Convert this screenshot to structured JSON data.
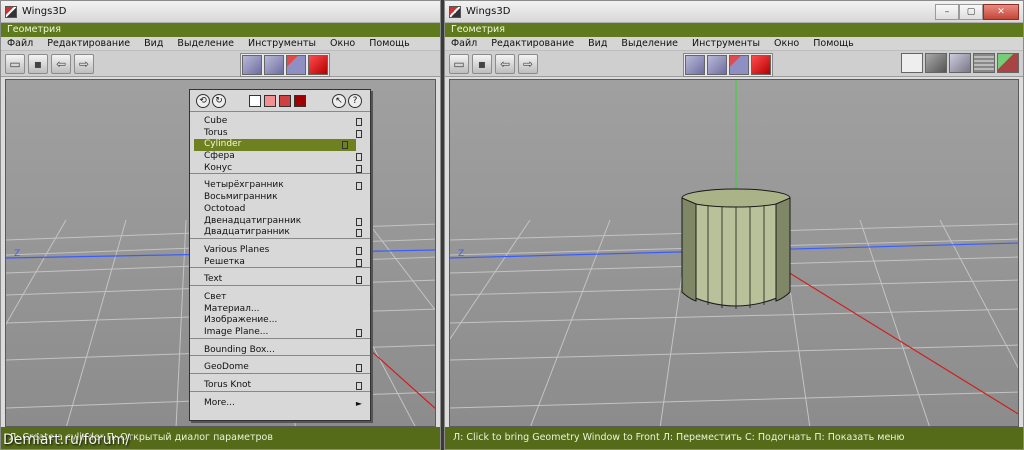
{
  "left_window": {
    "title": "Wings3D",
    "geometry_label": "Геометрия",
    "menu": [
      "Файл",
      "Редактирование",
      "Вид",
      "Выделение",
      "Инструменты",
      "Окно",
      "Помощь"
    ],
    "axis_label": "Z",
    "status_text": "Л: Create a cylinder  П: Открытый диалог параметров"
  },
  "right_window": {
    "title": "Wings3D",
    "geometry_label": "Геометрия",
    "menu": [
      "Файл",
      "Редактирование",
      "Вид",
      "Выделение",
      "Инструменты",
      "Окно",
      "Помощь"
    ],
    "axis_label": "Z",
    "status_text": "Л: Click to bring Geometry Window to Front   Л: Переместить   С: Подогнать   П: Показать меню"
  },
  "context_menu": {
    "items": [
      {
        "label": "Cube",
        "opt": true
      },
      {
        "label": "Torus",
        "opt": true
      },
      {
        "label": "Cylinder",
        "opt": true,
        "selected": true
      },
      {
        "label": "Сфера",
        "opt": true
      },
      {
        "label": "Конус",
        "opt": true,
        "sep": true
      },
      {
        "label": "Четырёхгранник",
        "opt": true
      },
      {
        "label": "Восьмигранник",
        "opt": false
      },
      {
        "label": "Octotoad",
        "opt": false
      },
      {
        "label": "Двенадцатигранник",
        "opt": true
      },
      {
        "label": "Двадцатигранник",
        "opt": true,
        "sep": true
      },
      {
        "label": "Various Planes",
        "opt": true
      },
      {
        "label": "Решетка",
        "opt": true,
        "sep": true
      },
      {
        "label": "Text",
        "opt": true,
        "sep": true
      },
      {
        "label": "Свет",
        "opt": false
      },
      {
        "label": "Материал...",
        "opt": false
      },
      {
        "label": "Изображение...",
        "opt": false
      },
      {
        "label": "Image Plane...",
        "opt": true,
        "sep": true
      },
      {
        "label": "Bounding Box...",
        "opt": false,
        "sep": true
      },
      {
        "label": "GeoDome",
        "opt": true,
        "sep": true
      },
      {
        "label": "Torus Knot",
        "opt": true,
        "sep": true
      },
      {
        "label": "More...",
        "opt": false,
        "submenu": true
      }
    ]
  },
  "watermark": "Demiart.ru/forum/",
  "colors": {
    "accent_green": "#5e7a1c",
    "selection_green": "#6e8020",
    "axis_green": "#3fd03f",
    "axis_blue": "#3a5cff",
    "axis_red": "#d01e1e"
  }
}
